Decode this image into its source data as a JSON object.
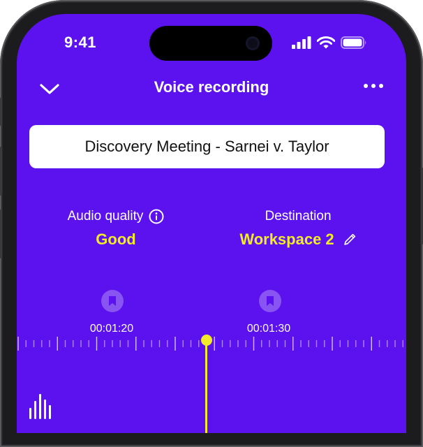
{
  "status_bar": {
    "time": "9:41"
  },
  "nav": {
    "title": "Voice recording",
    "back_icon": "chevron-down-icon",
    "more_icon": "more-icon"
  },
  "recording": {
    "title": "Discovery Meeting - Sarnei v. Taylor"
  },
  "audio_quality": {
    "label": "Audio quality",
    "value": "Good"
  },
  "destination": {
    "label": "Destination",
    "value": "Workspace 2"
  },
  "timeline": {
    "markers": [
      "00:01:20",
      "00:01:30"
    ]
  },
  "colors": {
    "background": "#5b12ee",
    "accent": "#f2ea2b",
    "text": "#ffffff"
  }
}
